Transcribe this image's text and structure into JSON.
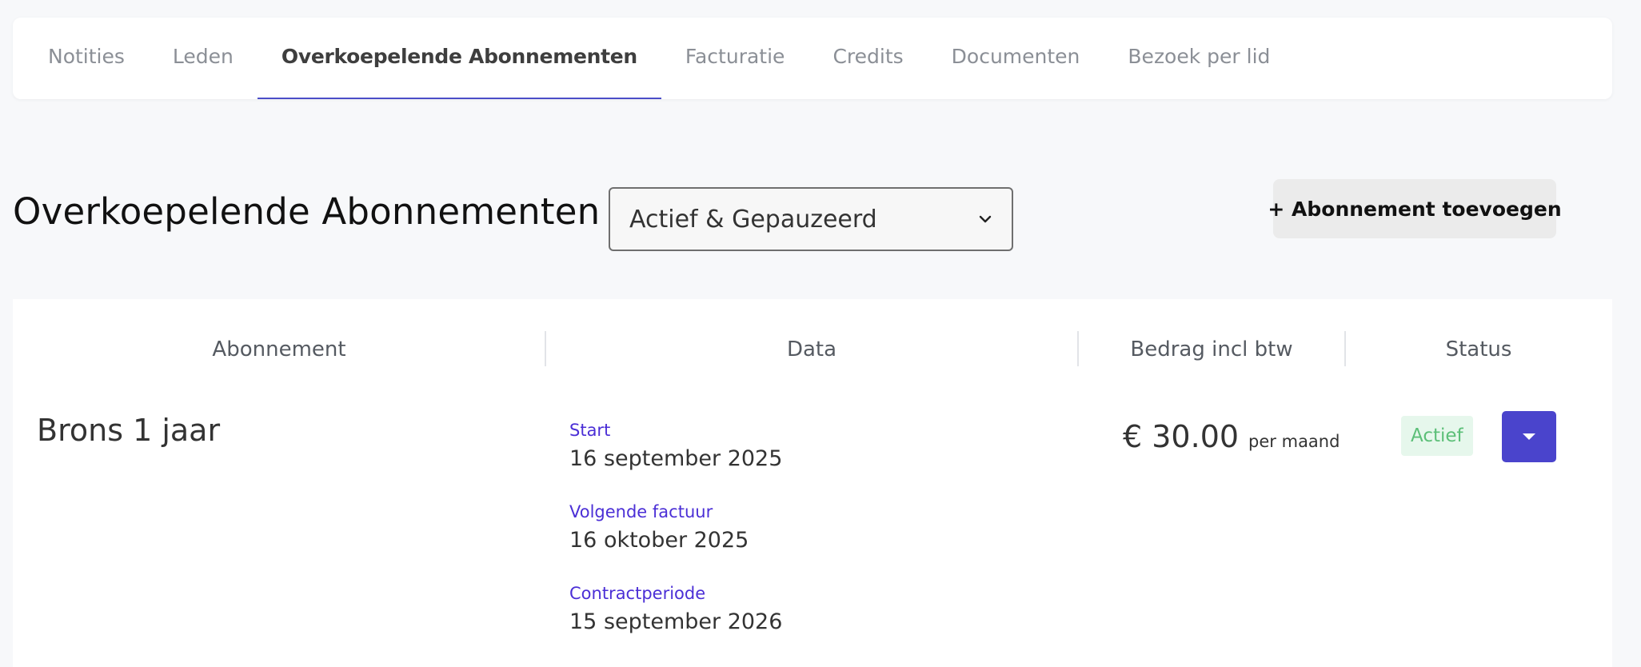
{
  "tabs": [
    {
      "label": "Notities"
    },
    {
      "label": "Leden"
    },
    {
      "label": "Overkoepelende Abonnementen"
    },
    {
      "label": "Facturatie"
    },
    {
      "label": "Credits"
    },
    {
      "label": "Documenten"
    },
    {
      "label": "Bezoek per lid"
    }
  ],
  "page": {
    "title": "Overkoepelende Abonnementen",
    "filter_value": "Actief & Gepauzeerd",
    "add_button_label": "+ Abonnement toevoegen"
  },
  "table": {
    "headers": {
      "subscription": "Abonnement",
      "dates": "Data",
      "amount": "Bedrag incl btw",
      "status": "Status"
    },
    "rows": [
      {
        "name": "Brons 1 jaar",
        "start_label": "Start",
        "start_value": "16 september 2025",
        "next_invoice_label": "Volgende factuur",
        "next_invoice_value": "16 oktober 2025",
        "contract_label": "Contractperiode",
        "contract_value": "15 september 2026",
        "price": "€ 30.00",
        "period": "per maand",
        "status": "Actief"
      }
    ]
  },
  "colors": {
    "accent": "#4a44cc",
    "date_label": "#4b2fd6",
    "status_bg": "#e6f7ec",
    "status_text": "#5cbf78",
    "background": "#f7f8fa"
  },
  "icons": {
    "select_chevron": "chevron-down-icon",
    "row_action": "caret-down-icon"
  }
}
